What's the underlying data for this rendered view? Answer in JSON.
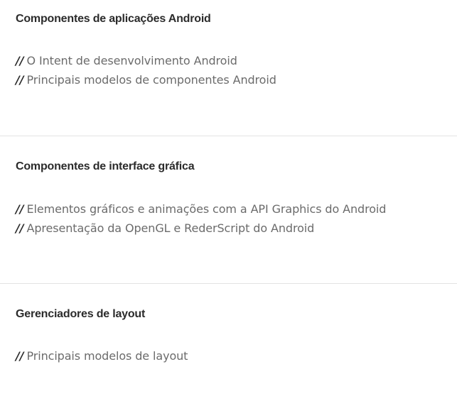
{
  "sections": [
    {
      "title": "Componentes de aplicações Android",
      "items": [
        {
          "marker": "//",
          "text": "O Intent de desenvolvimento Android"
        },
        {
          "marker": "//",
          "text": "Principais modelos de componentes Android"
        }
      ]
    },
    {
      "title": "Componentes de interface gráfica",
      "items": [
        {
          "marker": "//",
          "text": "Elementos gráficos e animações com a API Graphics do Android"
        },
        {
          "marker": "//",
          "text": "Apresentação da OpenGL e RederScript do Android"
        }
      ]
    },
    {
      "title": "Gerenciadores de layout",
      "items": [
        {
          "marker": "//",
          "text": "Principais modelos de layout"
        }
      ]
    }
  ],
  "colors": {
    "title": "#2b2b2b",
    "item_text": "#6b6b6b",
    "marker": "#2b2b2b",
    "divider": "#e3e3e3",
    "background": "#ffffff"
  }
}
